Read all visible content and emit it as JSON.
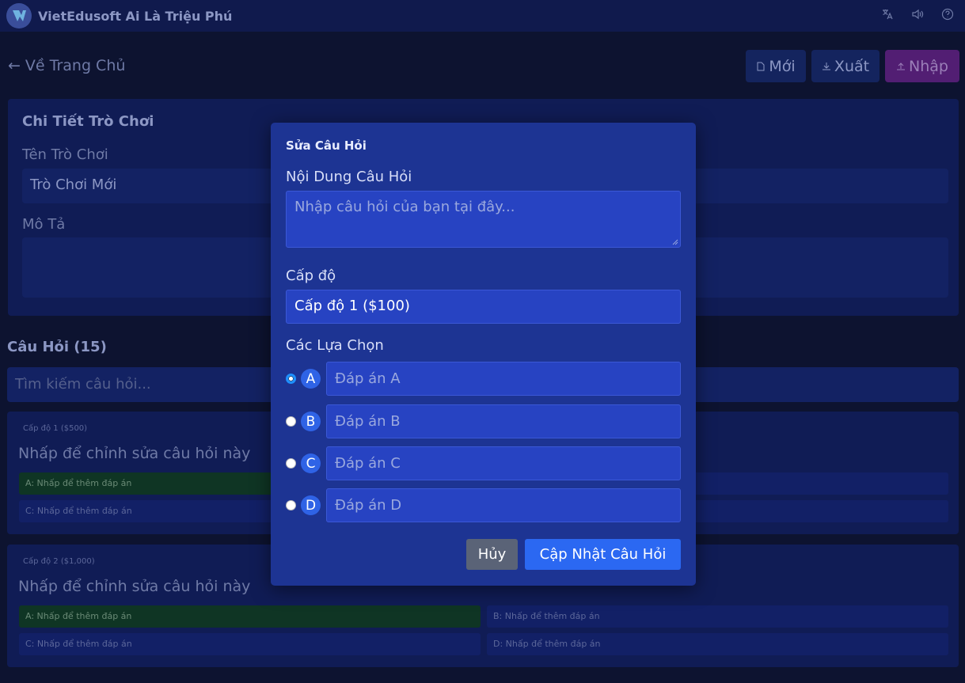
{
  "app": {
    "title": "VietEdusoft Ai Là Triệu Phú"
  },
  "header": {
    "icons": [
      "translate-icon",
      "volume-icon",
      "help-icon"
    ]
  },
  "nav": {
    "back_label": "Về Trang Chủ",
    "new_label": "Mới",
    "export_label": "Xuất",
    "import_label": "Nhập"
  },
  "details": {
    "heading": "Chi Tiết Trò Chơi",
    "name_label": "Tên Trò Chơi",
    "name_value": "Trò Chơi Mới",
    "desc_label": "Mô Tả"
  },
  "questions": {
    "heading": "Câu Hỏi (15)",
    "search_placeholder": "Tìm kiếm câu hỏi...",
    "cards": [
      {
        "level": "Cấp độ 1 ($500)",
        "text": "Nhấp để chỉnh sửa câu hỏi này",
        "a": "A: Nhấp để thêm đáp án",
        "b": "",
        "c": "C: Nhấp để thêm đáp án",
        "d": ""
      },
      {
        "level": "Cấp độ 2 ($1,000)",
        "text": "Nhấp để chỉnh sửa câu hỏi này",
        "a": "A: Nhấp để thêm đáp án",
        "b": "B: Nhấp để thêm đáp án",
        "c": "C: Nhấp để thêm đáp án",
        "d": "D: Nhấp để thêm đáp án"
      }
    ]
  },
  "modal": {
    "title": "Sửa Câu Hỏi",
    "question_label": "Nội Dung Câu Hỏi",
    "question_placeholder": "Nhập câu hỏi của bạn tại đây...",
    "level_label": "Cấp độ",
    "level_value": "Cấp độ 1 ($100)",
    "options_label": "Các Lựa Chọn",
    "options": [
      {
        "letter": "A",
        "placeholder": "Đáp án A",
        "selected": true
      },
      {
        "letter": "B",
        "placeholder": "Đáp án B",
        "selected": false
      },
      {
        "letter": "C",
        "placeholder": "Đáp án C",
        "selected": false
      },
      {
        "letter": "D",
        "placeholder": "Đáp án D",
        "selected": false
      }
    ],
    "cancel_label": "Hủy",
    "update_label": "Cập Nhật Câu Hỏi"
  },
  "colors": {
    "page_bg": "#0d1330",
    "modal_bg": "#1d3493",
    "primary": "#2b68f2",
    "import": "#521e73",
    "correct_answer": "#0f3524"
  }
}
